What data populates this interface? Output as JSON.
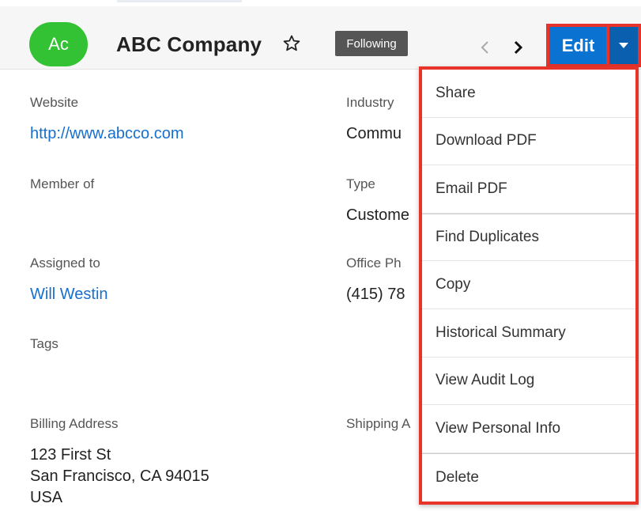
{
  "record": {
    "avatar_initials": "Ac",
    "avatar_color": "#33c234",
    "name": "ABC Company",
    "following_label": "Following",
    "edit_label": "Edit",
    "accent_color": "#0a72d1",
    "highlight_color": "#e8332b"
  },
  "fields": {
    "website": {
      "label": "Website",
      "value": "http://www.abcco.com"
    },
    "industry": {
      "label": "Industry",
      "value": "Commu"
    },
    "member_of": {
      "label": "Member of",
      "value": ""
    },
    "type": {
      "label": "Type",
      "value": "Custome"
    },
    "assigned_to": {
      "label": "Assigned to",
      "value": "Will Westin"
    },
    "office_phone": {
      "label": "Office Ph",
      "value": "(415) 78"
    },
    "tags": {
      "label": "Tags",
      "value": ""
    },
    "billing_address": {
      "label": "Billing Address",
      "lines": [
        "123 First St",
        "San Francisco, CA  94015",
        "USA"
      ]
    },
    "shipping_address": {
      "label": "Shipping A"
    }
  },
  "menu": {
    "items": [
      "Share",
      "Download PDF",
      "Email PDF",
      "Find Duplicates",
      "Copy",
      "Historical Summary",
      "View Audit Log",
      "View Personal Info",
      "Delete"
    ]
  },
  "icons": {
    "favorite": "star-outline-icon",
    "previous": "chevron-left-icon",
    "next": "chevron-right-icon",
    "toggle": "caret-down-icon"
  }
}
